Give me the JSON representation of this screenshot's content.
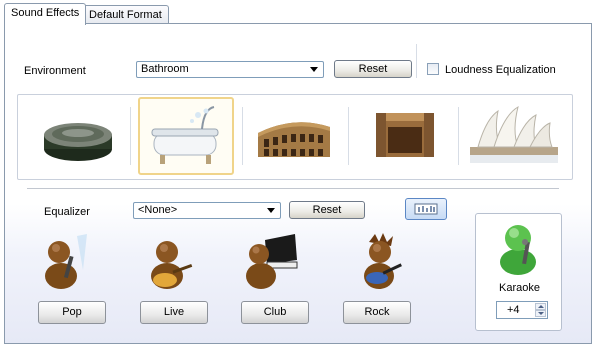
{
  "tabs": [
    {
      "label": "Sound Effects",
      "active": true
    },
    {
      "label": "Default Format",
      "active": false
    }
  ],
  "environment": {
    "label": "Environment",
    "selected": "Bathroom",
    "reset_label": "Reset",
    "loudness_label": "Loudness Equalization",
    "loudness_checked": false,
    "presets": [
      {
        "name": "stone-disc-icon"
      },
      {
        "name": "bathtub-icon",
        "selected": true
      },
      {
        "name": "colosseum-icon"
      },
      {
        "name": "stone-hall-icon"
      },
      {
        "name": "opera-house-icon"
      }
    ]
  },
  "equalizer": {
    "label": "Equalizer",
    "selected": "<None>",
    "reset_label": "Reset",
    "presets": [
      {
        "label": "Pop"
      },
      {
        "label": "Live"
      },
      {
        "label": "Club"
      },
      {
        "label": "Rock"
      }
    ]
  },
  "karaoke": {
    "label": "Karaoke",
    "value": "+4"
  },
  "colors": {
    "panel_border": "#8a9aad",
    "selected_thumb_border": "#f0d48a",
    "karaoke_green": "#3fa63a"
  }
}
